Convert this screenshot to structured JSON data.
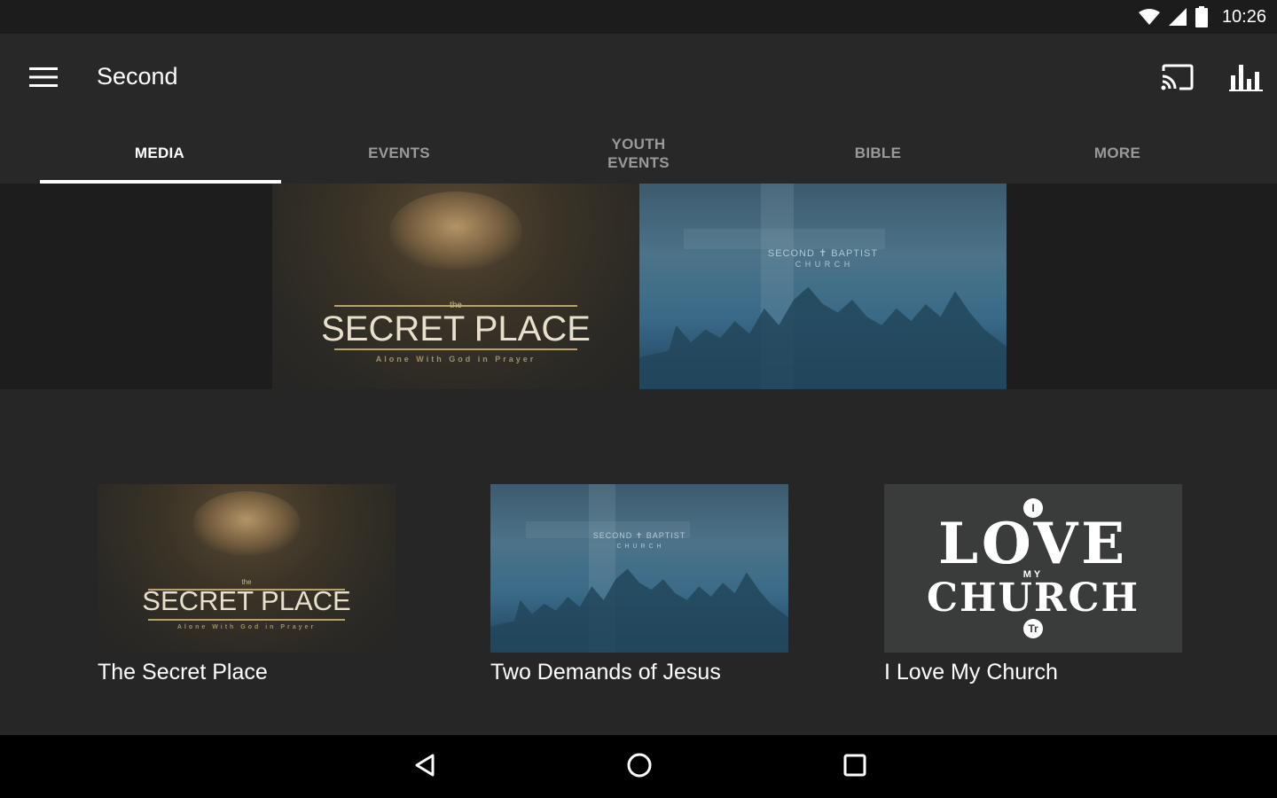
{
  "status_bar": {
    "time": "10:26",
    "icons": [
      "wifi-icon",
      "signal-icon",
      "battery-icon"
    ]
  },
  "app_bar": {
    "title": "Second",
    "menu_icon": "hamburger-menu-icon",
    "actions": [
      "cast-icon",
      "bar-chart-icon"
    ]
  },
  "tabs": [
    {
      "label": "MEDIA",
      "active": true
    },
    {
      "label": "EVENTS",
      "active": false
    },
    {
      "label": "YOUTH\nEVENTS",
      "active": false
    },
    {
      "label": "BIBLE",
      "active": false
    },
    {
      "label": "MORE",
      "active": false
    }
  ],
  "banner": {
    "items": [
      {
        "art": "secret-place",
        "the": "the",
        "headline": "SECRET PLACE",
        "tagline": "Alone With God in Prayer"
      },
      {
        "art": "two-demands",
        "logo_text": "SECOND ✝ BAPTIST",
        "logo_sub": "C H U R C H"
      }
    ]
  },
  "media_items": [
    {
      "title": "The Secret Place",
      "art": {
        "the": "the",
        "headline": "SECRET PLACE",
        "tagline": "Alone With God in Prayer"
      }
    },
    {
      "title": "Two Demands of Jesus",
      "art": {
        "logo_text": "SECOND ✝ BAPTIST",
        "logo_sub": "C H U R C H"
      }
    },
    {
      "title": "I Love My Church",
      "art": {
        "top_badge": "I",
        "word1": "LOVE",
        "word2": "MY",
        "word3": "CHURCH",
        "bottom_badge": "Tr"
      }
    }
  ],
  "nav_bar": {
    "buttons": [
      "back-icon",
      "home-icon",
      "recents-icon"
    ]
  },
  "colors": {
    "background": "#262626",
    "app_bar": "#282828",
    "status_bar": "#1c1c1c",
    "tab_active": "#ffffff",
    "tab_inactive": "#9a9a9a",
    "nav_bar": "#000000"
  }
}
